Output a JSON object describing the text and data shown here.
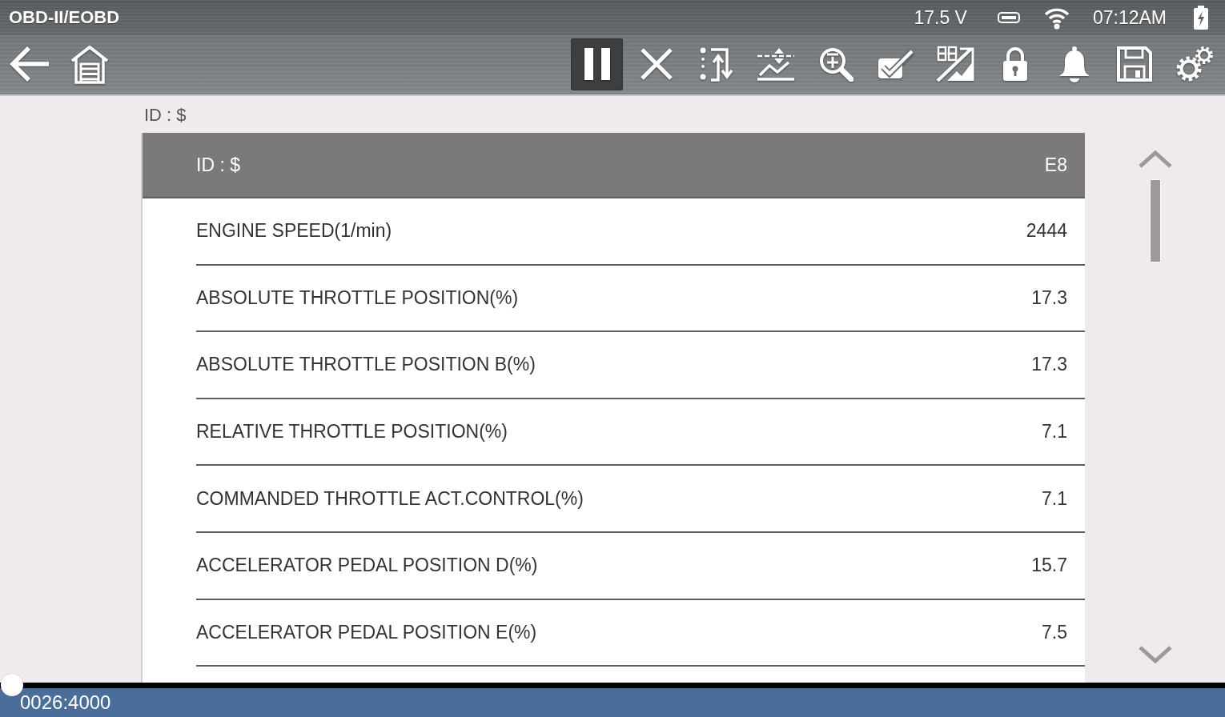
{
  "status_bar": {
    "title": "OBD-II/EOBD",
    "voltage": "17.5 V",
    "time": "07:12AM"
  },
  "toolbar": {
    "buttons": [
      {
        "active": true
      },
      {
        "active": false
      },
      {
        "active": false
      },
      {
        "active": false
      },
      {
        "active": false
      },
      {
        "active": false
      },
      {
        "active": false
      },
      {
        "active": false
      },
      {
        "active": false
      },
      {
        "active": false
      },
      {
        "active": false
      }
    ]
  },
  "breadcrumb": "ID : $",
  "table": {
    "header": {
      "label": "ID : $",
      "value": "E8"
    },
    "rows": [
      {
        "name": "ENGINE SPEED(1/min)",
        "value": "2444"
      },
      {
        "name": "ABSOLUTE THROTTLE POSITION(%)",
        "value": "17.3"
      },
      {
        "name": "ABSOLUTE THROTTLE POSITION B(%)",
        "value": "17.3"
      },
      {
        "name": "RELATIVE THROTTLE POSITION(%)",
        "value": "7.1"
      },
      {
        "name": "COMMANDED THROTTLE ACT.CONTROL(%)",
        "value": "7.1"
      },
      {
        "name": "ACCELERATOR PEDAL POSITION D(%)",
        "value": "15.7"
      },
      {
        "name": "ACCELERATOR PEDAL POSITION E(%)",
        "value": "7.5"
      }
    ]
  },
  "playback": {
    "level": 0.01,
    "counter": "0026:4000"
  }
}
